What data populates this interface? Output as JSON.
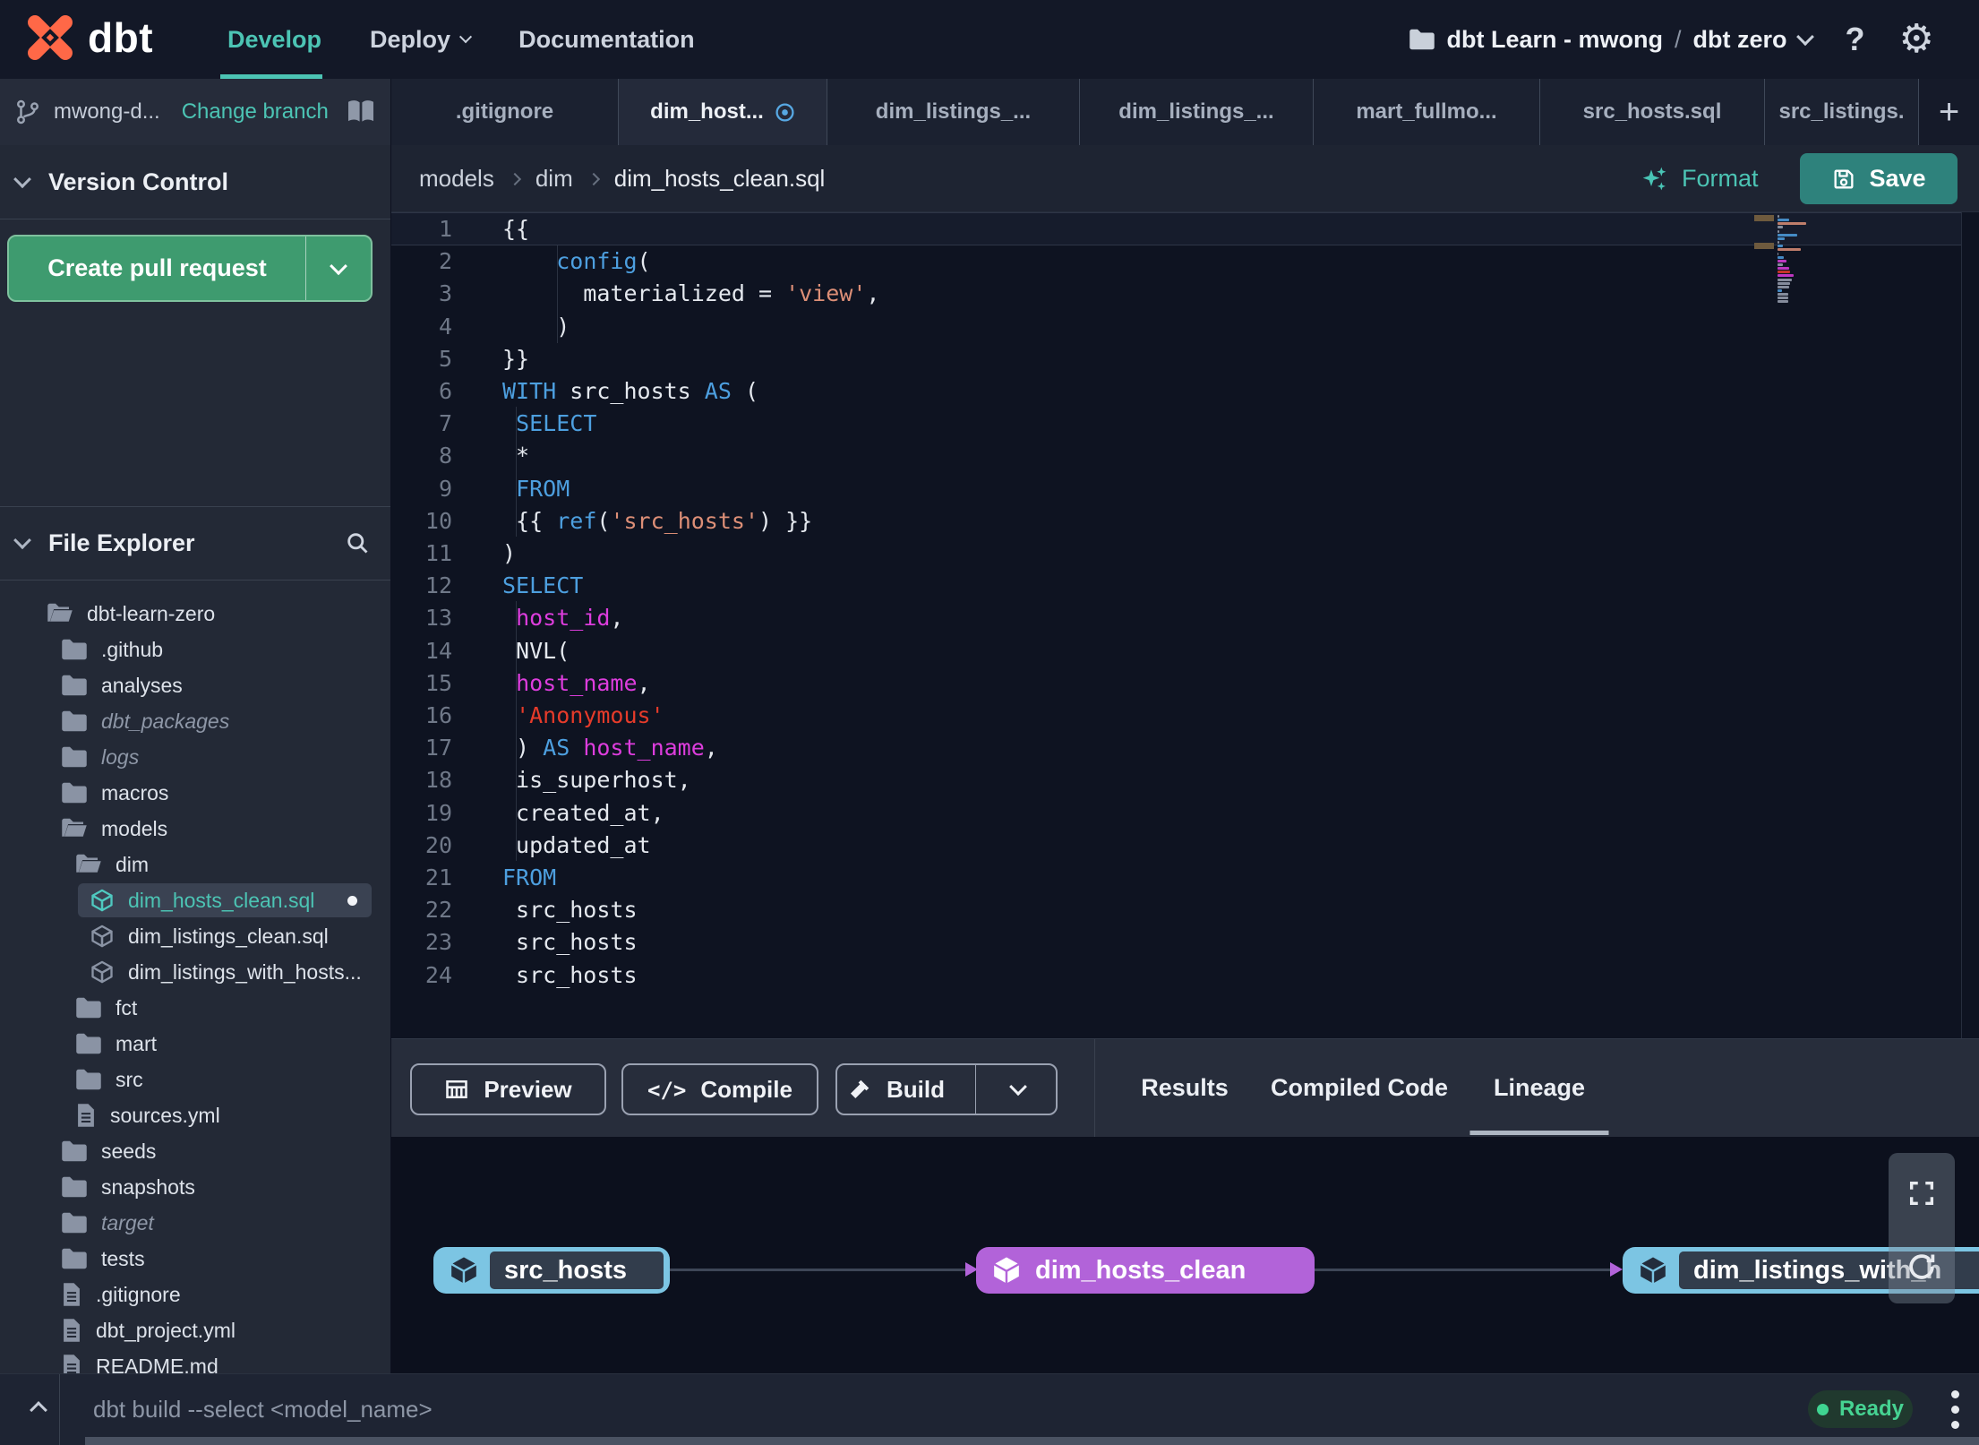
{
  "topbar": {
    "brand": "dbt",
    "nav": [
      {
        "label": "Develop",
        "active": true
      },
      {
        "label": "Deploy",
        "has_dropdown": true
      },
      {
        "label": "Documentation"
      }
    ],
    "project": {
      "account": "dbt Learn - mwong",
      "separator": "/",
      "project": "dbt zero"
    }
  },
  "branch_bar": {
    "branch": "mwong-d...",
    "change_branch": "Change branch"
  },
  "version_control": {
    "header": "Version Control",
    "create_pr": "Create pull request"
  },
  "file_explorer": {
    "header": "File Explorer",
    "tree": [
      {
        "label": "dbt-learn-zero",
        "type": "folder-open",
        "depth": 0
      },
      {
        "label": ".github",
        "type": "folder",
        "depth": 1
      },
      {
        "label": "analyses",
        "type": "folder",
        "depth": 1
      },
      {
        "label": "dbt_packages",
        "type": "folder",
        "depth": 1,
        "italic": true
      },
      {
        "label": "logs",
        "type": "folder",
        "depth": 1,
        "italic": true
      },
      {
        "label": "macros",
        "type": "folder",
        "depth": 1
      },
      {
        "label": "models",
        "type": "folder-open",
        "depth": 1
      },
      {
        "label": "dim",
        "type": "folder-open",
        "depth": 2
      },
      {
        "label": "dim_hosts_clean.sql",
        "type": "model",
        "depth": 3,
        "selected": true,
        "modified": true
      },
      {
        "label": "dim_listings_clean.sql",
        "type": "model",
        "depth": 3
      },
      {
        "label": "dim_listings_with_hosts...",
        "type": "model",
        "depth": 3
      },
      {
        "label": "fct",
        "type": "folder",
        "depth": 2
      },
      {
        "label": "mart",
        "type": "folder",
        "depth": 2
      },
      {
        "label": "src",
        "type": "folder",
        "depth": 2
      },
      {
        "label": "sources.yml",
        "type": "file",
        "depth": 2
      },
      {
        "label": "seeds",
        "type": "folder",
        "depth": 1
      },
      {
        "label": "snapshots",
        "type": "folder",
        "depth": 1
      },
      {
        "label": "target",
        "type": "folder",
        "depth": 1,
        "italic": true
      },
      {
        "label": "tests",
        "type": "folder",
        "depth": 1
      },
      {
        "label": ".gitignore",
        "type": "file",
        "depth": 1
      },
      {
        "label": "dbt_project.yml",
        "type": "file",
        "depth": 1
      },
      {
        "label": "README.md",
        "type": "file",
        "depth": 1
      }
    ]
  },
  "tabs": [
    {
      "label": ".gitignore"
    },
    {
      "label": "dim_host...",
      "active": true,
      "modified": true
    },
    {
      "label": "dim_listings_..."
    },
    {
      "label": "dim_listings_..."
    },
    {
      "label": "mart_fullmo..."
    },
    {
      "label": "src_hosts.sql"
    },
    {
      "label": "src_listings."
    }
  ],
  "breadcrumb": {
    "items": [
      "models",
      "dim",
      "dim_hosts_clean.sql"
    ]
  },
  "editor_actions": {
    "format": "Format",
    "save": "Save"
  },
  "editor": {
    "lines": [
      {
        "n": 1,
        "current": true,
        "tokens": [
          [
            "pl",
            "{{"
          ]
        ]
      },
      {
        "n": 2,
        "tokens": [
          [
            "pl",
            "    "
          ],
          [
            "kw",
            "config"
          ],
          [
            "pl",
            "("
          ]
        ]
      },
      {
        "n": 3,
        "tokens": [
          [
            "pl",
            "      materialized = "
          ],
          [
            "str",
            "'view'"
          ],
          [
            "pl",
            ","
          ]
        ]
      },
      {
        "n": 4,
        "tokens": [
          [
            "pl",
            "    )"
          ]
        ]
      },
      {
        "n": 5,
        "tokens": [
          [
            "pl",
            "}}"
          ]
        ]
      },
      {
        "n": 6,
        "tokens": [
          [
            "kw",
            "WITH"
          ],
          [
            "pl",
            " src_hosts "
          ],
          [
            "kw",
            "AS"
          ],
          [
            "pl",
            " ("
          ]
        ]
      },
      {
        "n": 7,
        "tokens": [
          [
            "pl",
            " "
          ],
          [
            "kw",
            "SELECT"
          ]
        ]
      },
      {
        "n": 8,
        "tokens": [
          [
            "pl",
            " *"
          ]
        ]
      },
      {
        "n": 9,
        "tokens": [
          [
            "pl",
            " "
          ],
          [
            "kw",
            "FROM"
          ]
        ]
      },
      {
        "n": 10,
        "tokens": [
          [
            "pl",
            " {{ "
          ],
          [
            "kw",
            "ref"
          ],
          [
            "pl",
            "("
          ],
          [
            "str",
            "'src_hosts'"
          ],
          [
            "pl",
            ") }}"
          ]
        ]
      },
      {
        "n": 11,
        "tokens": [
          [
            "pl",
            ")"
          ]
        ]
      },
      {
        "n": 12,
        "tokens": [
          [
            "kw",
            "SELECT"
          ]
        ]
      },
      {
        "n": 13,
        "tokens": [
          [
            "pl",
            " "
          ],
          [
            "col",
            "host_id"
          ],
          [
            "pl",
            ","
          ]
        ]
      },
      {
        "n": 14,
        "tokens": [
          [
            "pl",
            " NVL("
          ]
        ]
      },
      {
        "n": 15,
        "tokens": [
          [
            "pl",
            " "
          ],
          [
            "col",
            "host_name"
          ],
          [
            "pl",
            ","
          ]
        ]
      },
      {
        "n": 16,
        "tokens": [
          [
            "pl",
            " "
          ],
          [
            "strsql",
            "'Anonymous'"
          ]
        ]
      },
      {
        "n": 17,
        "tokens": [
          [
            "pl",
            " ) "
          ],
          [
            "kw",
            "AS"
          ],
          [
            "pl",
            " "
          ],
          [
            "col",
            "host_name"
          ],
          [
            "pl",
            ","
          ]
        ]
      },
      {
        "n": 18,
        "tokens": [
          [
            "pl",
            " is_superhost,"
          ]
        ]
      },
      {
        "n": 19,
        "tokens": [
          [
            "pl",
            " created_at,"
          ]
        ]
      },
      {
        "n": 20,
        "tokens": [
          [
            "pl",
            " updated_at"
          ]
        ]
      },
      {
        "n": 21,
        "tokens": [
          [
            "kw",
            "FROM"
          ]
        ]
      },
      {
        "n": 22,
        "tokens": [
          [
            "pl",
            " src_hosts"
          ]
        ]
      },
      {
        "n": 23,
        "tokens": [
          [
            "pl",
            " src_hosts"
          ]
        ]
      },
      {
        "n": 24,
        "tokens": [
          [
            "pl",
            " src_hosts"
          ]
        ]
      }
    ]
  },
  "bottom_panel": {
    "buttons": [
      {
        "label": "Preview",
        "icon": "table"
      },
      {
        "label": "Compile",
        "icon": "code"
      },
      {
        "label": "Build",
        "icon": "hammer",
        "split": true
      }
    ],
    "tabs": [
      {
        "label": "Results"
      },
      {
        "label": "Compiled Code"
      },
      {
        "label": "Lineage",
        "active": true
      }
    ]
  },
  "lineage": {
    "nodes": [
      {
        "label": "src_hosts",
        "kind": "source"
      },
      {
        "label": "dim_hosts_clean",
        "kind": "selected"
      },
      {
        "label": "dim_listings_with_h",
        "kind": "source"
      }
    ]
  },
  "statusbar": {
    "command": "dbt build --select <model_name>",
    "status": "Ready"
  },
  "colors": {
    "accent_teal": "#4cc4b4",
    "brand_orange": "#ff6847",
    "pr_green": "#3e9b6f",
    "save_teal": "#2e827c",
    "node_blue": "#7cc5e3",
    "node_purple": "#b263d9",
    "ready_green": "#46d392",
    "keyword_blue": "#4d9fdf",
    "string_salmon": "#dd8f77",
    "string_red": "#e63b2a",
    "identifier_magenta": "#dd3ddd"
  }
}
